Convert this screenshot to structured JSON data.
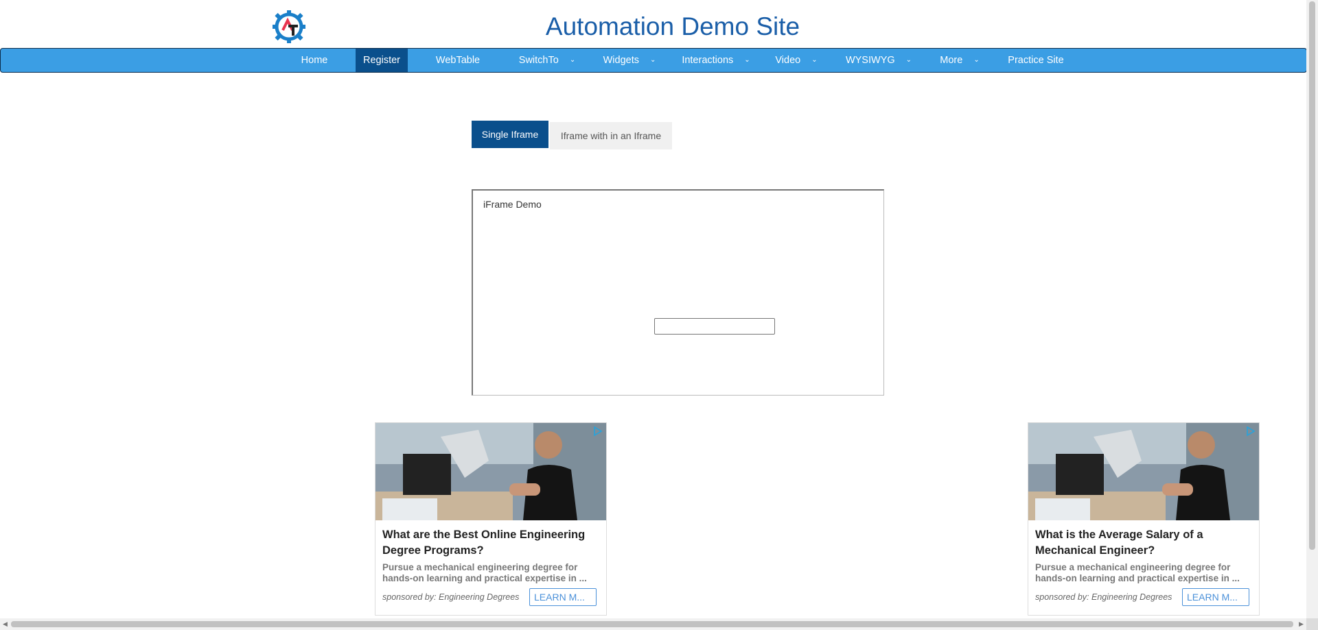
{
  "header": {
    "title": "Automation Demo Site",
    "logo_letters": "AT"
  },
  "nav": {
    "items": [
      {
        "label": "Home",
        "dropdown": false,
        "active": false
      },
      {
        "label": "Register",
        "dropdown": false,
        "active": true
      },
      {
        "label": "WebTable",
        "dropdown": false,
        "active": false
      },
      {
        "label": "SwitchTo",
        "dropdown": true,
        "active": false
      },
      {
        "label": "Widgets",
        "dropdown": true,
        "active": false
      },
      {
        "label": "Interactions",
        "dropdown": true,
        "active": false
      },
      {
        "label": "Video",
        "dropdown": true,
        "active": false
      },
      {
        "label": "WYSIWYG",
        "dropdown": true,
        "active": false
      },
      {
        "label": "More",
        "dropdown": true,
        "active": false
      },
      {
        "label": "Practice Site",
        "dropdown": false,
        "active": false
      }
    ],
    "chevron": "⌄"
  },
  "tabs": {
    "single": "Single Iframe",
    "nested": "Iframe with in an Iframe"
  },
  "iframe": {
    "title": "iFrame Demo",
    "input_value": ""
  },
  "ads": [
    {
      "headline": "What are the Best Online Engineering Degree Programs?",
      "description": "Pursue a mechanical engineering degree for hands-on learning and practical expertise in ...",
      "sponsor": "sponsored by: Engineering Degrees",
      "cta": "LEARN M..."
    },
    {
      "headline": "What is the Average Salary of a Mechanical Engineer?",
      "description": "Pursue a mechanical engineering degree for hands-on learning and practical expertise in ...",
      "sponsor": "sponsored by: Engineering Degrees",
      "cta": "LEARN M..."
    }
  ],
  "colors": {
    "brand_blue": "#1a5ea8",
    "nav_bg": "#3b9ee4",
    "active_bg": "#0a4f8c",
    "logo_red": "#e8344e"
  }
}
